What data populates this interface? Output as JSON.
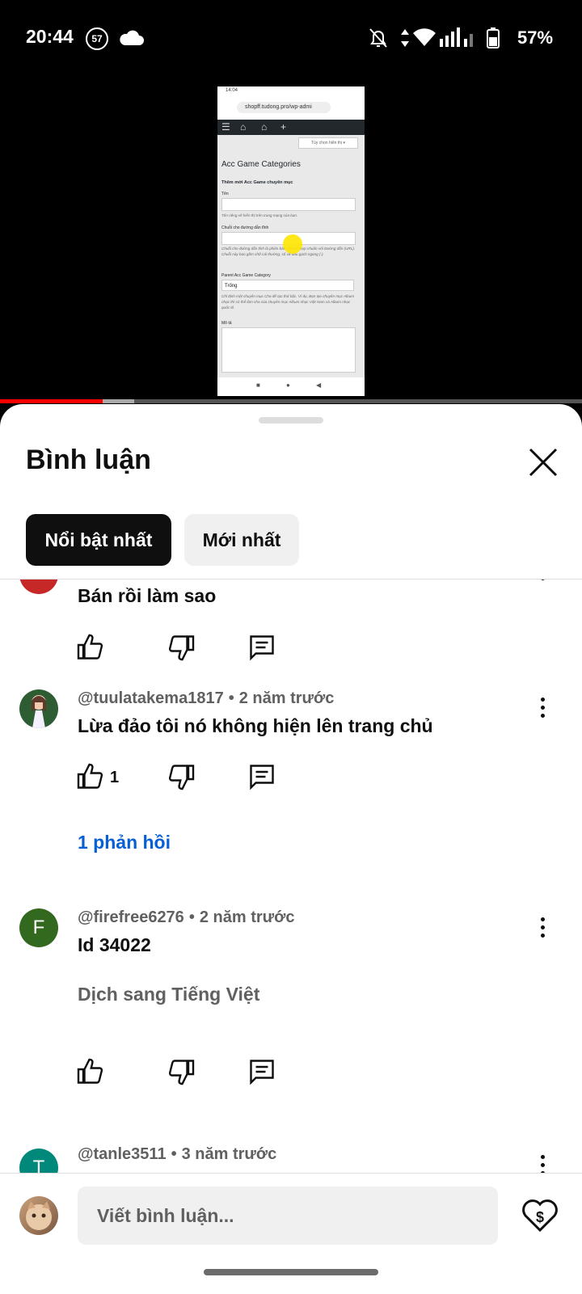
{
  "status_bar": {
    "time": "20:44",
    "notif_count": "57",
    "battery": "57%"
  },
  "video": {
    "phone_screen": {
      "status_time": "14:04",
      "url": "shopff.tudong.pro/wp-admi",
      "options_label": "Tùy chọn hiển thị ▾",
      "page_title": "Acc Game Categories",
      "section_title": "Thêm mới Acc Game chuyên mục",
      "field_name_label": "Tên",
      "field_name_help": "Tên riêng sẽ hiển thị trên trang mạng của bạn.",
      "field_slug_label": "Chuỗi cho đường dẫn tĩnh",
      "field_slug_help": "Chuỗi cho đường dẫn tĩnh là phiên bản của tên hợp chuẩn với Đường dẫn (URL). Chuỗi này bao gồm chữ cái thường, số và dấu gạch ngang (-).",
      "parent_label": "Parent Acc Game Category",
      "parent_value": "Trống",
      "parent_help": "Chỉ định một chuyên mục Cha để tạo thứ bậc. Ví dụ, Bạn tạo chuyên mục Album nhạc thì có thể làm cha của chuyên mục Album nhạc Việt Nam và Album nhạc quốc tế.",
      "desc_label": "Mô tả"
    },
    "progress_played": 0.176,
    "progress_buffered": 0.23
  },
  "comments_panel": {
    "title": "Bình luận",
    "filters": {
      "top": "Nổi bật nhất",
      "newest": "Mới nhất"
    },
    "comments": [
      {
        "author": "",
        "time": "",
        "text": "Bán rồi làm sao",
        "likes": ""
      },
      {
        "author": "@tuulatakema1817",
        "time": "2 năm trước",
        "text": "Lừa đảo tôi nó không hiện lên trang chủ",
        "likes": "1",
        "replies": "1 phản hồi"
      },
      {
        "author": "@firefree6276",
        "time": "2 năm trước",
        "text": "Id 34022",
        "translate": "Dịch sang Tiếng Việt",
        "likes": "",
        "avatar_letter": "F"
      },
      {
        "author": "@tanle3511",
        "time": "3 năm trước",
        "avatar_letter": "T"
      }
    ],
    "add_comment_placeholder": "Viết bình luận..."
  },
  "colors": {
    "accent_link": "#065fd4",
    "progress": "#ff0000",
    "avatar_f": "#33691e",
    "avatar_t": "#00897b"
  }
}
